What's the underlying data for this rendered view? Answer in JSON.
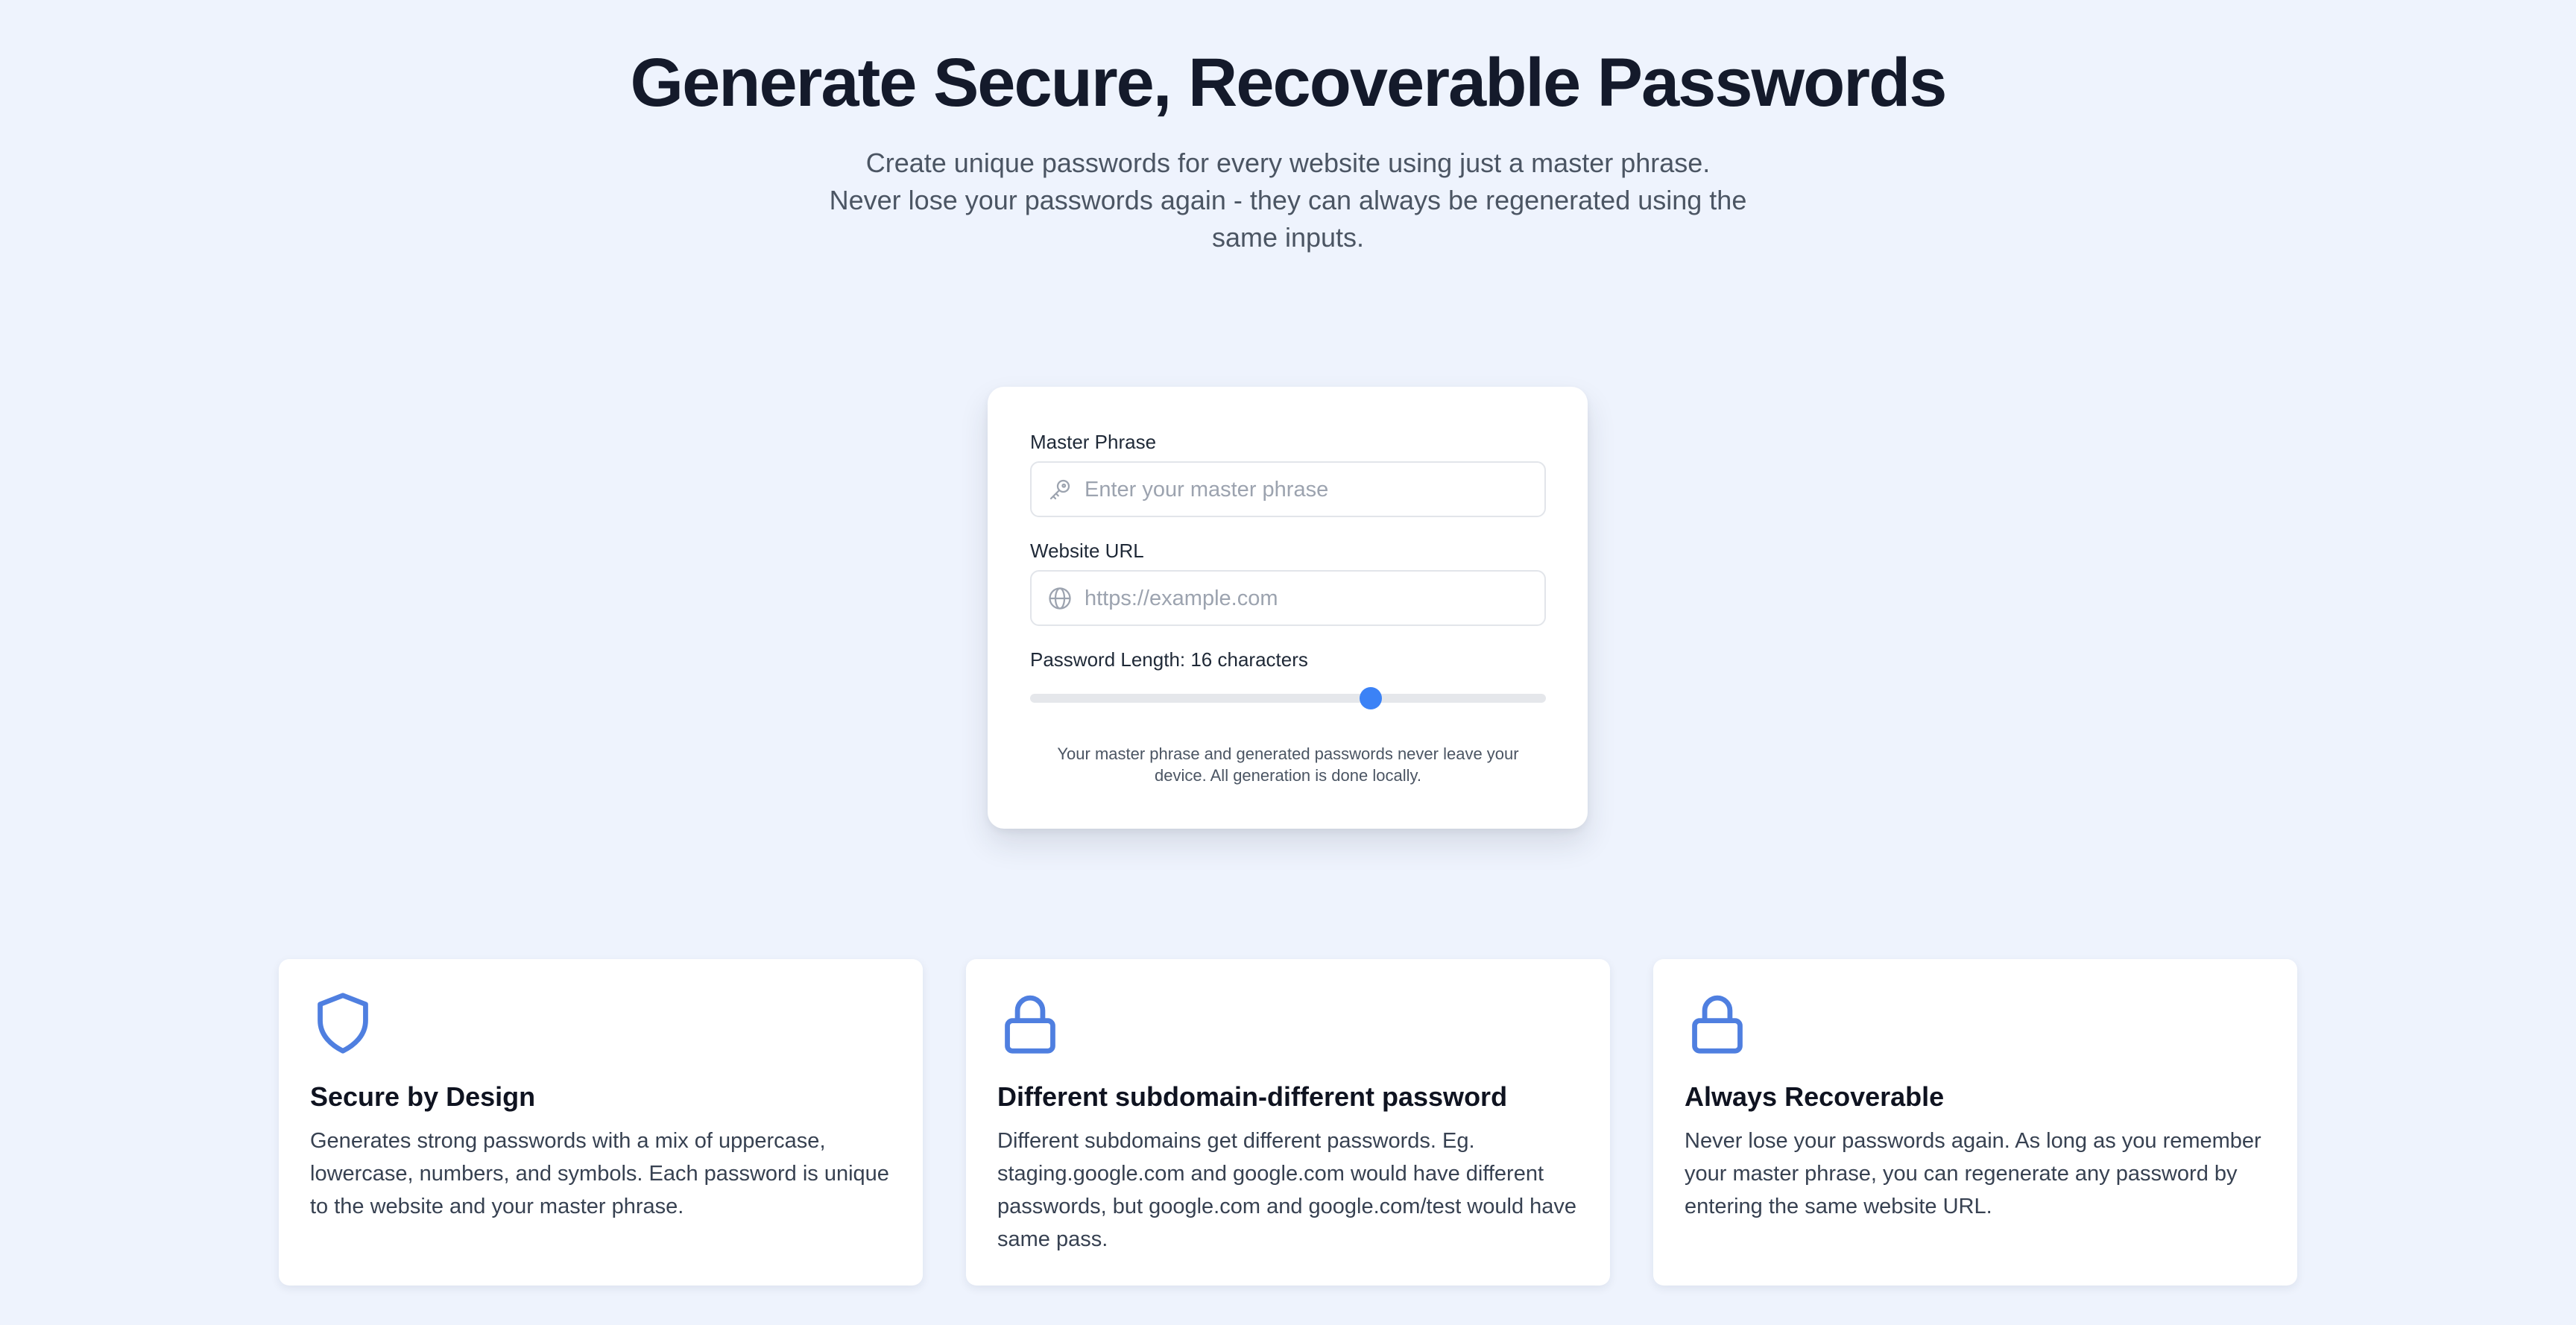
{
  "hero": {
    "title": "Generate Secure, Recoverable Passwords",
    "subtitle": "Create unique passwords for every website using just a master phrase. Never lose your passwords again - they can always be regenerated using the same inputs."
  },
  "form": {
    "master_phrase": {
      "label": "Master Phrase",
      "placeholder": "Enter your master phrase",
      "value": "",
      "icon": "key-icon"
    },
    "website_url": {
      "label": "Website URL",
      "placeholder": "https://example.com",
      "value": "",
      "icon": "globe-icon"
    },
    "password_length": {
      "label": "Password Length: 16 characters",
      "value": 16,
      "slider_fraction": 0.66
    },
    "privacy_note": "Your master phrase and generated passwords never leave your device. All generation is done locally."
  },
  "features": [
    {
      "icon": "shield-icon",
      "title": "Secure by Design",
      "description": "Generates strong passwords with a mix of uppercase, lowercase, numbers, and symbols. Each password is unique to the website and your master phrase."
    },
    {
      "icon": "lock-icon",
      "title": "Different subdomain-different password",
      "description": "Different subdomains get different passwords. Eg. staging.google.com and google.com would have different passwords, but google.com and google.com/test would have same pass."
    },
    {
      "icon": "lock-icon",
      "title": "Always Recoverable",
      "description": "Never lose your passwords again. As long as you remember your master phrase, you can regenerate any password by entering the same website URL."
    }
  ],
  "colors": {
    "background": "#eef3fd",
    "accent": "#3b82f6",
    "icon": "#4f7fe0"
  }
}
